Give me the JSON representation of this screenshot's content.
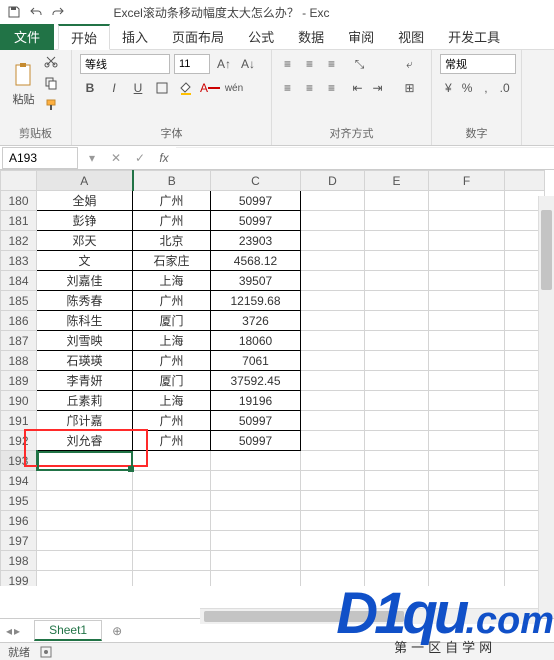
{
  "title": "Excel滚动条移动幅度太大怎么办？ - Exc",
  "tabs": {
    "file": "文件",
    "home": "开始",
    "insert": "插入",
    "layout": "页面布局",
    "formulas": "公式",
    "data": "数据",
    "review": "审阅",
    "view": "视图",
    "dev": "开发工具"
  },
  "ribbon": {
    "clipboard": {
      "paste": "粘贴",
      "label": "剪贴板"
    },
    "font": {
      "name": "等线",
      "size": "11",
      "label": "字体",
      "bold": "B",
      "italic": "I",
      "underline": "U"
    },
    "align": {
      "label": "对齐方式"
    },
    "num": {
      "format": "常规",
      "label": "数字"
    }
  },
  "nameBox": "A193",
  "fx": "fx",
  "cols": [
    "",
    "A",
    "B",
    "C",
    "D",
    "E",
    "F"
  ],
  "rows": [
    {
      "n": "180",
      "a": "全娟",
      "b": "广州",
      "c": "50997"
    },
    {
      "n": "181",
      "a": "彭铮",
      "b": "广州",
      "c": "50997"
    },
    {
      "n": "182",
      "a": "邓天",
      "b": "北京",
      "c": "23903"
    },
    {
      "n": "183",
      "a": "文",
      "b": "石家庄",
      "c": "4568.12"
    },
    {
      "n": "184",
      "a": "刘嘉佳",
      "b": "上海",
      "c": "39507"
    },
    {
      "n": "185",
      "a": "陈秀春",
      "b": "广州",
      "c": "12159.68"
    },
    {
      "n": "186",
      "a": "陈科生",
      "b": "厦门",
      "c": "3726"
    },
    {
      "n": "187",
      "a": "刘雪映",
      "b": "上海",
      "c": "18060"
    },
    {
      "n": "188",
      "a": "石瑛瑛",
      "b": "广州",
      "c": "7061"
    },
    {
      "n": "189",
      "a": "李青妍",
      "b": "厦门",
      "c": "37592.45"
    },
    {
      "n": "190",
      "a": "丘素莉",
      "b": "上海",
      "c": "19196"
    },
    {
      "n": "191",
      "a": "邝计嘉",
      "b": "广州",
      "c": "50997"
    },
    {
      "n": "192",
      "a": "刘允睿",
      "b": "广州",
      "c": "50997"
    },
    {
      "n": "193",
      "a": "",
      "b": "",
      "c": ""
    },
    {
      "n": "194",
      "a": "",
      "b": "",
      "c": ""
    },
    {
      "n": "195",
      "a": "",
      "b": "",
      "c": ""
    },
    {
      "n": "196",
      "a": "",
      "b": "",
      "c": ""
    },
    {
      "n": "197",
      "a": "",
      "b": "",
      "c": ""
    },
    {
      "n": "198",
      "a": "",
      "b": "",
      "c": ""
    },
    {
      "n": "199",
      "a": "",
      "b": "",
      "c": ""
    }
  ],
  "sheetTab": "Sheet1",
  "addSheet": "⊕",
  "status": "就绪",
  "watermark": {
    "brand": "D1qu",
    "suffix": ".com",
    "sub": "第一区自学网"
  }
}
